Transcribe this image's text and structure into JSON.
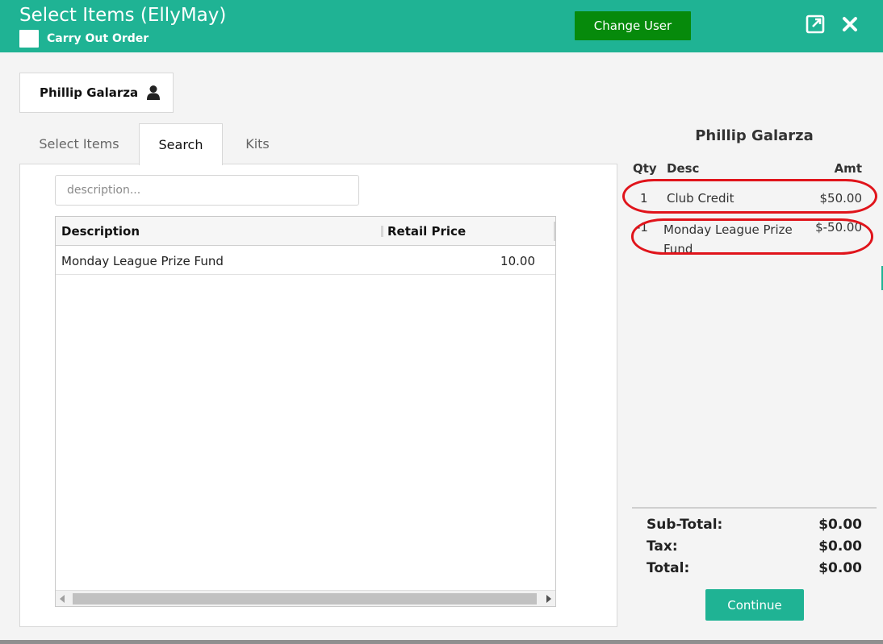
{
  "header": {
    "title": "Select Items (EllyMay)",
    "carry_out_label": "Carry Out Order",
    "change_user_label": "Change User",
    "accent": "#1fb394",
    "button_color": "#068a0b",
    "icons": [
      "expand-icon",
      "close-icon"
    ]
  },
  "customer": {
    "name": "Phillip Galarza",
    "icon": "person-icon"
  },
  "tabs": [
    {
      "label": "Select Items",
      "active": false
    },
    {
      "label": "Search",
      "active": true
    },
    {
      "label": "Kits",
      "active": false
    }
  ],
  "search": {
    "placeholder": "description...",
    "value": ""
  },
  "grid": {
    "columns": [
      "Description",
      "Retail Price"
    ],
    "rows": [
      {
        "description": "Monday League Prize Fund",
        "price": "10.00"
      }
    ]
  },
  "order": {
    "customer_name": "Phillip Galarza",
    "columns": {
      "qty": "Qty",
      "desc": "Desc",
      "amt": "Amt"
    },
    "lines": [
      {
        "qty": "1",
        "desc": "Club Credit",
        "amt": "$50.00"
      },
      {
        "qty": "-1",
        "desc": "Monday League Prize Fund",
        "amt": "$-50.00"
      }
    ],
    "highlight_color": "#e0141b"
  },
  "totals": {
    "subtotal_label": "Sub-Total:",
    "subtotal": "$0.00",
    "tax_label": "Tax:",
    "tax": "$0.00",
    "total_label": "Total:",
    "total": "$0.00"
  },
  "continue_label": "Continue"
}
